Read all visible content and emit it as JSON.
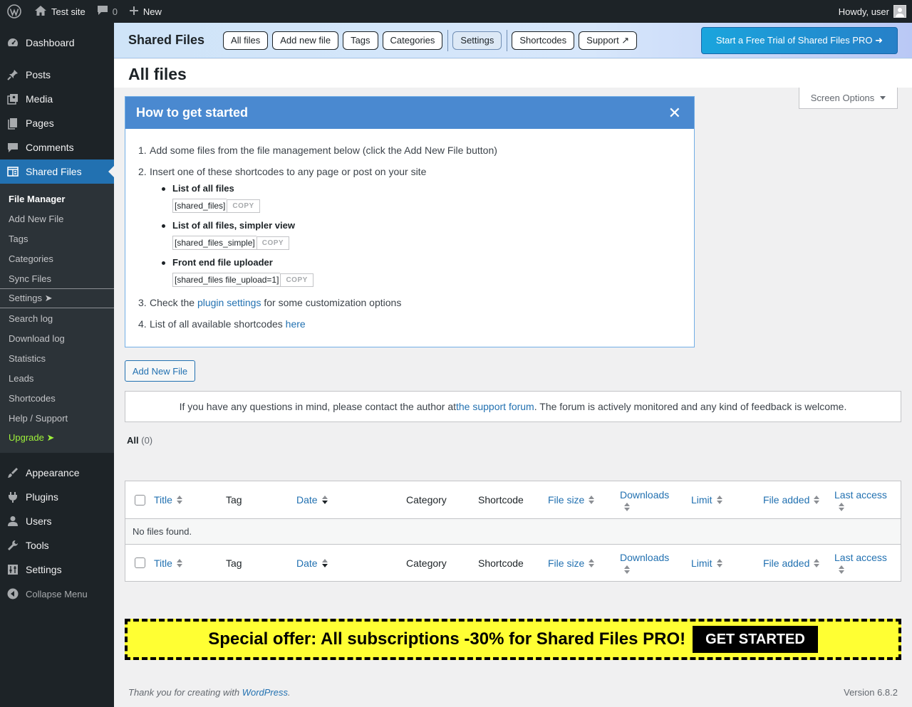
{
  "adminbar": {
    "site_name": "Test site",
    "comment_count": "0",
    "new_label": "New",
    "howdy": "Howdy, user"
  },
  "sidebar": {
    "items": [
      {
        "label": "Dashboard",
        "icon": "dashboard-icon"
      },
      {
        "label": "Posts",
        "icon": "pin-icon"
      },
      {
        "label": "Media",
        "icon": "media-icon"
      },
      {
        "label": "Pages",
        "icon": "pages-icon"
      },
      {
        "label": "Comments",
        "icon": "comment-icon"
      },
      {
        "label": "Shared Files",
        "icon": "shared-files-icon"
      },
      {
        "label": "Appearance",
        "icon": "brush-icon"
      },
      {
        "label": "Plugins",
        "icon": "plug-icon"
      },
      {
        "label": "Users",
        "icon": "user-icon"
      },
      {
        "label": "Tools",
        "icon": "wrench-icon"
      },
      {
        "label": "Settings",
        "icon": "sliders-icon"
      },
      {
        "label": "Collapse Menu",
        "icon": "collapse-icon"
      }
    ],
    "submenu": [
      "File Manager",
      "Add New File",
      "Tags",
      "Categories",
      "Sync Files",
      "Settings ➤",
      "Search log",
      "Download log",
      "Statistics",
      "Leads",
      "Shortcodes",
      "Help / Support",
      "Upgrade ➤"
    ]
  },
  "plugin_header": {
    "title": "Shared Files",
    "tabs": [
      "All files",
      "Add new file",
      "Tags",
      "Categories",
      "Settings",
      "Shortcodes",
      "Support ↗"
    ],
    "trial_button": "Start a Free Trial of Shared Files PRO ➜"
  },
  "page_title": "All files",
  "screen_options": "Screen Options",
  "howto": {
    "title": "How to get started",
    "close": "✕",
    "step1": "Add some files from the file management below (click the Add New File button)",
    "step2": "Insert one of these shortcodes to any page or post on your site",
    "shortcodes": [
      {
        "label": "List of all files",
        "code": "[shared_files]",
        "copy": "COPY"
      },
      {
        "label": "List of all files, simpler view",
        "code": "[shared_files_simple]",
        "copy": "COPY"
      },
      {
        "label": "Front end file uploader",
        "code": "[shared_files file_upload=1]",
        "copy": "COPY"
      }
    ],
    "step3_pre": "Check the ",
    "step3_link": "plugin settings",
    "step3_post": " for some customization options",
    "step4_pre": "List of all available shortcodes ",
    "step4_link": "here",
    "numbers": [
      "1.",
      "2.",
      "3.",
      "4."
    ]
  },
  "add_new_button": "Add New File",
  "notice": {
    "pre": "If you have any questions in mind, please contact the author at ",
    "link": "the support forum",
    "post": ". The forum is actively monitored and any kind of feedback is welcome."
  },
  "views": {
    "all_label": "All",
    "all_count": "(0)"
  },
  "table": {
    "columns": [
      "Title",
      "Tag",
      "Date",
      "Category",
      "Shortcode",
      "File size",
      "Downloads",
      "Limit",
      "File added",
      "Last access"
    ],
    "empty_message": "No files found."
  },
  "offer": {
    "text": "Special offer: All subscriptions -30% for Shared Files PRO!",
    "button": "GET STARTED"
  },
  "footer": {
    "thanks_pre": "Thank you for creating with ",
    "thanks_link": "WordPress",
    "thanks_post": ".",
    "version": "Version 6.8.2"
  },
  "colors": {
    "admin_dark": "#1d2327",
    "accent": "#2271b1",
    "upgrade_green": "#9ff13b",
    "howto_header": "#4a89d0",
    "offer_yellow": "#ffff33"
  }
}
